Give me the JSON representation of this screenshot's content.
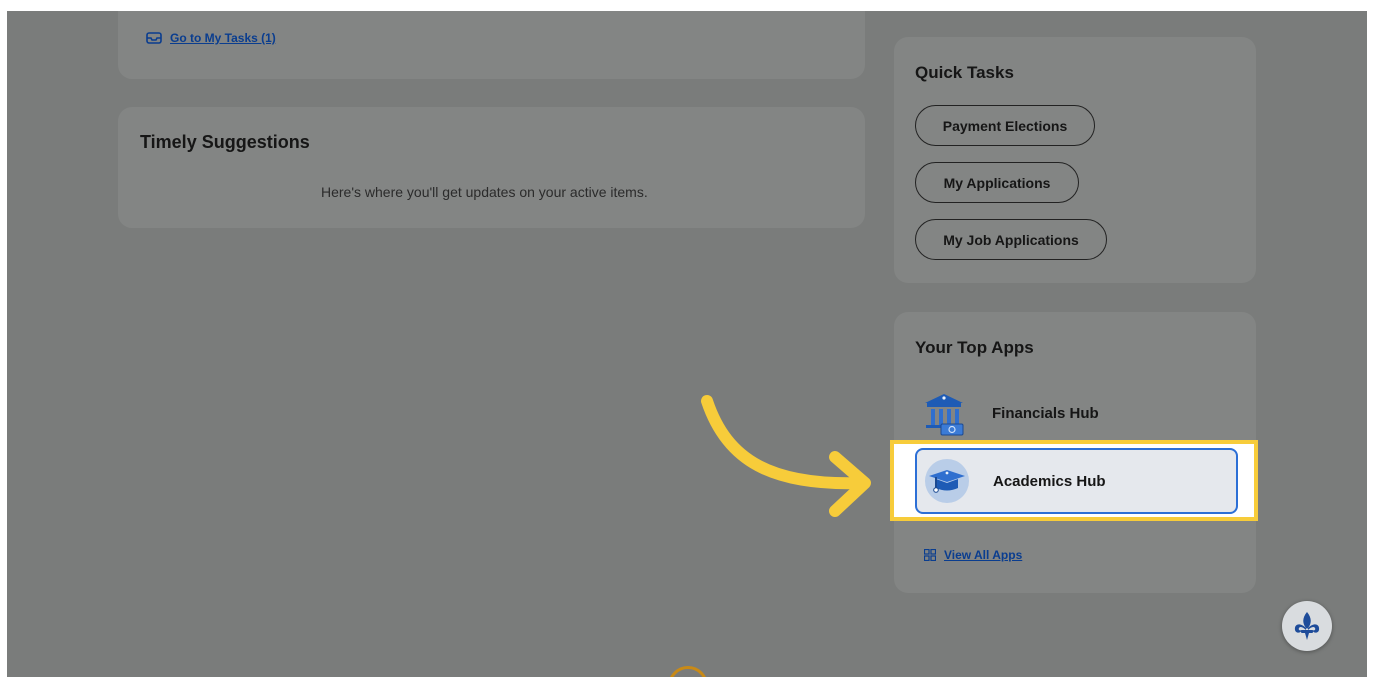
{
  "tasks_card": {
    "link_label": "Go to My Tasks (1)",
    "icon": "inbox-icon"
  },
  "timely": {
    "title": "Timely Suggestions",
    "message": "Here's where you'll get updates on your active items."
  },
  "quick_tasks": {
    "title": "Quick Tasks",
    "items": [
      "Payment Elections",
      "My Applications",
      "My Job Applications"
    ]
  },
  "top_apps": {
    "title": "Your Top Apps",
    "apps": [
      {
        "label": "Financials Hub",
        "icon": "bank-building-icon"
      },
      {
        "label": "Academics Hub",
        "icon": "graduation-cap-icon"
      }
    ],
    "view_all_label": "View All Apps",
    "view_all_icon": "grid-icon"
  },
  "colors": {
    "overlay": "#7a7c7b",
    "card": "#838584",
    "link": "#0a3d8f",
    "highlight": "#f7cc3a",
    "selection_border": "#2c6fd6",
    "annotation_arrow": "#f7cc3a"
  },
  "fab_icon": "fleur-de-lis-icon"
}
